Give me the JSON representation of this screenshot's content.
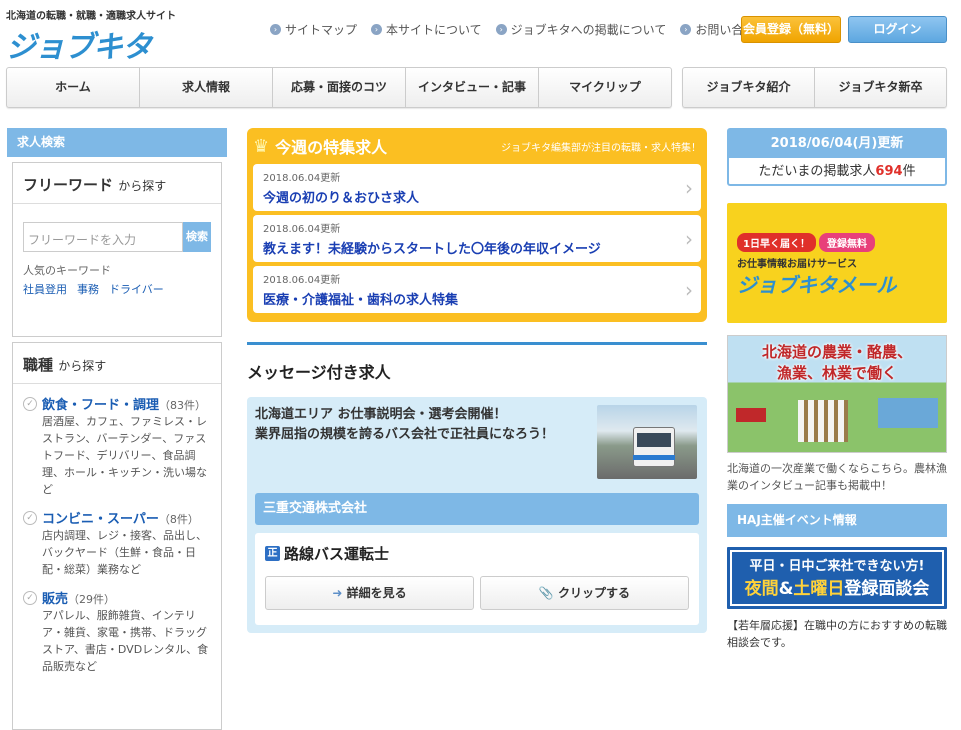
{
  "header": {
    "tagline": "北海道の転職・就職・適職求人サイト",
    "logo": "ジョブキタ",
    "links": [
      "サイトマップ",
      "本サイトについて",
      "ジョブキタへの掲載について",
      "お問い合わせ"
    ],
    "register_label": "会員登録（無料）",
    "login_label": "ログイン"
  },
  "nav": {
    "main": [
      "ホーム",
      "求人情報",
      "応募・面接のコツ",
      "インタビュー・記事",
      "マイクリップ"
    ],
    "sub": [
      "ジョブキタ紹介",
      "ジョブキタ新卒"
    ]
  },
  "left": {
    "heading": "求人検索",
    "freeword": {
      "title": "フリーワード",
      "suffix": "から探す",
      "placeholder": "フリーワードを入力",
      "search_label": "検索",
      "popular_label": "人気のキーワード",
      "keywords": [
        "社員登用",
        "事務",
        "ドライバー"
      ]
    },
    "jobtype": {
      "title": "職種",
      "suffix": "から探す",
      "categories": [
        {
          "name": "飲食・フード・調理",
          "count": "（83件）",
          "desc": "居酒屋、カフェ、ファミレス・レストラン、バーテンダー、ファストフード、デリバリー、食品調理、ホール・キッチン・洗い場など"
        },
        {
          "name": "コンビニ・スーパー",
          "count": "（8件）",
          "desc": "店内調理、レジ・接客、品出し、バックヤード（生鮮・食品・日配・総菜）業務など"
        },
        {
          "name": "販売",
          "count": "（29件）",
          "desc": "アパレル、服飾雑貨、インテリア・雑貨、家電・携帯、ドラッグストア、書店・DVDレンタル、食品販売など"
        }
      ]
    }
  },
  "center": {
    "featured": {
      "title": "今週の特集求人",
      "subtitle": "ジョブキタ編集部が注目の転職・求人特集！",
      "items": [
        {
          "date": "2018.06.04更新",
          "title": "今週の初のり＆おひさ求人"
        },
        {
          "date": "2018.06.04更新",
          "title": "教えます！未経験からスタートした〇年後の年収イメージ"
        },
        {
          "date": "2018.06.04更新",
          "title": "医療・介護福祉・歯科の求人特集"
        }
      ]
    },
    "message_heading": "メッセージ付き求人",
    "message": {
      "text1": "北海道エリア お仕事説明会・選考会開催！",
      "text2": "業界屈指の規模を誇るバス会社で正社員になろう！",
      "company": "三重交通株式会社",
      "badge": "正",
      "job_title": "路線バス運転士",
      "detail_label": "詳細を見る",
      "clip_label": "クリップする"
    }
  },
  "right": {
    "update_date": "2018/06/04(月)更新",
    "listing_prefix": "ただいまの掲載求人",
    "listing_count": "694",
    "listing_suffix": "件",
    "mail_banner": {
      "b1": "1日早く届く！",
      "b2": "登録無料",
      "b3": "お仕事情報お届けサービス",
      "b4": "ジョブキタメール"
    },
    "farm_banner": {
      "line1": "北海道の農業・酪農、",
      "line2": "漁業、林業で働く"
    },
    "farm_text": "北海道の一次産業で働くならこちら。農林漁業のインタビュー記事も掲載中！",
    "haj_heading": "HAJ主催イベント情報",
    "event_banner": {
      "e1": "平日・日中ご来社できない方!",
      "e2a": "夜間",
      "e2b": "&",
      "e2c": "土曜日",
      "e2d": "登録面談会"
    },
    "event_text": "【若年層応援】在職中の方におすすめの転職相談会です。"
  }
}
